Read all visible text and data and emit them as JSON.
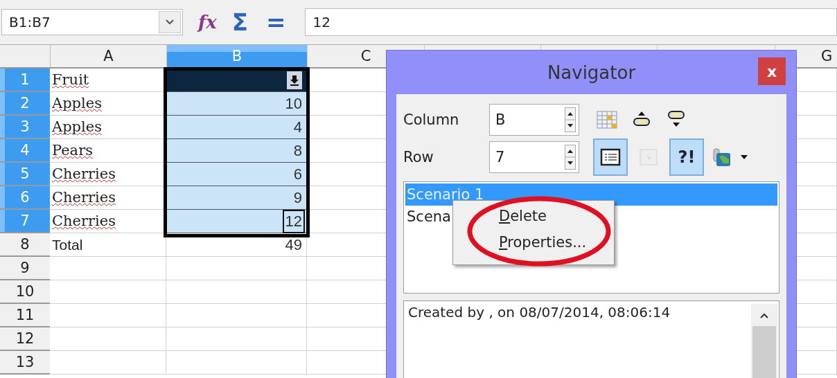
{
  "formula_bar": {
    "name_box": "B1:B7",
    "function_wizard": "fx",
    "sum": "Σ",
    "equals": "=",
    "formula": "12"
  },
  "columns": [
    {
      "label": "A",
      "selected": false
    },
    {
      "label": "B",
      "selected": true
    },
    {
      "label": "C",
      "selected": false
    },
    {
      "label": "G",
      "selected": false
    }
  ],
  "rows": [
    {
      "number": "1",
      "selected": true,
      "fruit": "Fruit",
      "misspelled": true,
      "dark": true,
      "filter_button": true
    },
    {
      "number": "2",
      "selected": true,
      "fruit": "Apples",
      "misspelled": true,
      "value": "10"
    },
    {
      "number": "3",
      "selected": true,
      "fruit": "Apples",
      "misspelled": true,
      "value": "4"
    },
    {
      "number": "4",
      "selected": true,
      "fruit": "Pears",
      "misspelled": true,
      "value": "8"
    },
    {
      "number": "5",
      "selected": true,
      "fruit": "Cherries",
      "misspelled": true,
      "value": "6"
    },
    {
      "number": "6",
      "selected": true,
      "fruit": "Cherries",
      "misspelled": true,
      "value": "9"
    },
    {
      "number": "7",
      "selected": true,
      "fruit": "Cherries",
      "misspelled": true,
      "value": "12",
      "active": true
    },
    {
      "number": "8",
      "selected": false,
      "fruit": "Total",
      "misspelled": false,
      "kind": "total",
      "value": "49"
    },
    {
      "number": "9",
      "selected": false
    },
    {
      "number": "10",
      "selected": false
    },
    {
      "number": "11",
      "selected": false
    },
    {
      "number": "12",
      "selected": false
    },
    {
      "number": "13",
      "selected": false
    }
  ],
  "navigator": {
    "title": "Navigator",
    "close": "x",
    "fields": [
      {
        "label": "Column",
        "value": "B"
      },
      {
        "label": "Row",
        "value": "7"
      }
    ],
    "toolbar_rows": [
      [
        {
          "kind": "data-range",
          "selected": false
        },
        {
          "kind": "arrow-up",
          "selected": false
        },
        {
          "kind": "arrow-down",
          "selected": false
        }
      ],
      [
        {
          "kind": "contents",
          "selected": true
        },
        {
          "kind": "toggle",
          "selected": false,
          "disabled": true
        },
        {
          "kind": "scenarios",
          "selected": true,
          "label": "?!"
        },
        {
          "kind": "documents",
          "selected": false
        }
      ]
    ],
    "scenarios": [
      {
        "text": "Scenario 1",
        "selected": true
      },
      {
        "text": "Scena",
        "selected": false
      }
    ],
    "context_menu": [
      {
        "label": "Delete",
        "mnemonic": true
      },
      {
        "label": "Properties...",
        "mnemonic": true
      }
    ],
    "comment": "Created by  , on 08/07/2014, 08:06:14"
  }
}
